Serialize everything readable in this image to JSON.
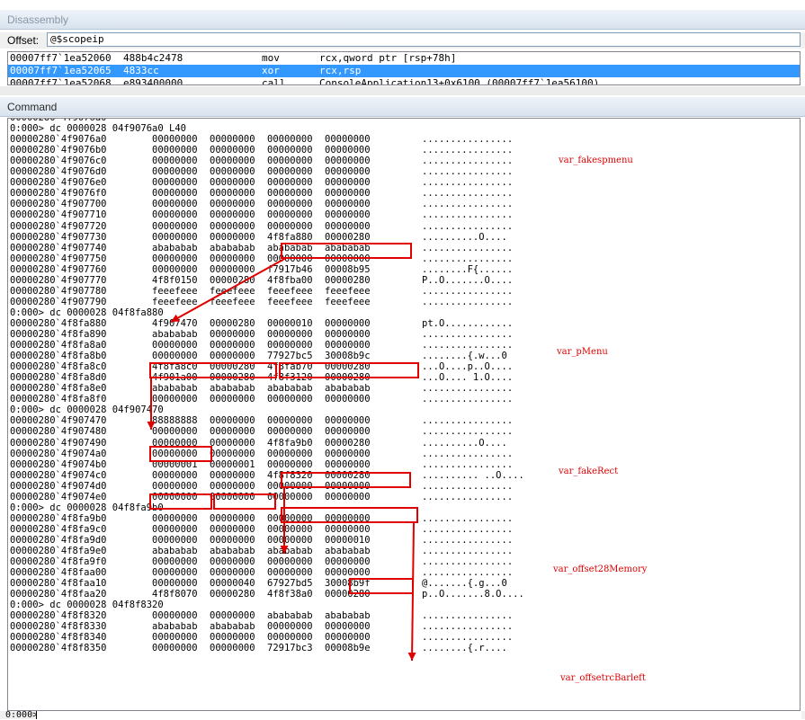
{
  "disassembly": {
    "title": "Disassembly",
    "offset_label": "Offset:",
    "offset_value": "@$scopeip",
    "lines": [
      {
        "addr": "00007ff7`1ea52060",
        "bytes": "488b4c2478",
        "op": "mov",
        "args": "rcx,qword ptr [rsp+78h]",
        "selected": false
      },
      {
        "addr": "00007ff7`1ea52065",
        "bytes": "4833cc",
        "op": "xor",
        "args": "rcx,rsp",
        "selected": true
      },
      {
        "addr": "00007ff7`1ea52068",
        "bytes": "e893400000",
        "op": "call",
        "args": "ConsoleApplication13+0x6100 (00007ff7`1ea56100)",
        "selected": false
      }
    ]
  },
  "command": {
    "title": "Command",
    "lines": [
      {
        "t": "row",
        "a": "00000280`4f9076a0",
        "w": [
          "",
          "",
          "",
          ""
        ],
        "s": ""
      },
      {
        "t": "cmd",
        "text": "0:000> dc 0000028 04f9076a0 L40"
      },
      {
        "t": "row",
        "a": "00000280`4f9076a0",
        "w": [
          "00000000",
          "00000000",
          "00000000",
          "00000000"
        ],
        "s": "................"
      },
      {
        "t": "row",
        "a": "00000280`4f9076b0",
        "w": [
          "00000000",
          "00000000",
          "00000000",
          "00000000"
        ],
        "s": "................"
      },
      {
        "t": "row",
        "a": "00000280`4f9076c0",
        "w": [
          "00000000",
          "00000000",
          "00000000",
          "00000000"
        ],
        "s": "................"
      },
      {
        "t": "row",
        "a": "00000280`4f9076d0",
        "w": [
          "00000000",
          "00000000",
          "00000000",
          "00000000"
        ],
        "s": "................"
      },
      {
        "t": "row",
        "a": "00000280`4f9076e0",
        "w": [
          "00000000",
          "00000000",
          "00000000",
          "00000000"
        ],
        "s": "................"
      },
      {
        "t": "row",
        "a": "00000280`4f9076f0",
        "w": [
          "00000000",
          "00000000",
          "00000000",
          "00000000"
        ],
        "s": "................"
      },
      {
        "t": "row",
        "a": "00000280`4f907700",
        "w": [
          "00000000",
          "00000000",
          "00000000",
          "00000000"
        ],
        "s": "................"
      },
      {
        "t": "row",
        "a": "00000280`4f907710",
        "w": [
          "00000000",
          "00000000",
          "00000000",
          "00000000"
        ],
        "s": "................"
      },
      {
        "t": "row",
        "a": "00000280`4f907720",
        "w": [
          "00000000",
          "00000000",
          "00000000",
          "00000000"
        ],
        "s": "................"
      },
      {
        "t": "row",
        "a": "00000280`4f907730",
        "w": [
          "00000000",
          "00000000",
          "4f8fa880",
          "00000280"
        ],
        "s": "..........O...."
      },
      {
        "t": "row",
        "a": "00000280`4f907740",
        "w": [
          "abababab",
          "abababab",
          "abababab",
          "abababab"
        ],
        "s": "................"
      },
      {
        "t": "row",
        "a": "00000280`4f907750",
        "w": [
          "00000000",
          "00000000",
          "00000000",
          "00000000"
        ],
        "s": "................"
      },
      {
        "t": "row",
        "a": "00000280`4f907760",
        "w": [
          "00000000",
          "00000000",
          "f7917b46",
          "00008b95"
        ],
        "s": "........F{......"
      },
      {
        "t": "row",
        "a": "00000280`4f907770",
        "w": [
          "4f8f0150",
          "00000280",
          "4f8fba00",
          "00000280"
        ],
        "s": "P..O.......O...."
      },
      {
        "t": "row",
        "a": "00000280`4f907780",
        "w": [
          "feeefeee",
          "feeefeee",
          "feeefeee",
          "feeefeee"
        ],
        "s": "................"
      },
      {
        "t": "row",
        "a": "00000280`4f907790",
        "w": [
          "feeefeee",
          "feeefeee",
          "feeefeee",
          "feeefeee"
        ],
        "s": "................"
      },
      {
        "t": "cmd",
        "text": "0:000> dc 0000028 04f8fa880"
      },
      {
        "t": "row",
        "a": "00000280`4f8fa880",
        "w": [
          "4f907470",
          "00000280",
          "00000010",
          "00000000"
        ],
        "s": "pt.O............"
      },
      {
        "t": "row",
        "a": "00000280`4f8fa890",
        "w": [
          "abababab",
          "00000000",
          "00000000",
          "00000000"
        ],
        "s": "................"
      },
      {
        "t": "row",
        "a": "00000280`4f8fa8a0",
        "w": [
          "00000000",
          "00000000",
          "00000000",
          "00000000"
        ],
        "s": "................"
      },
      {
        "t": "row",
        "a": "00000280`4f8fa8b0",
        "w": [
          "00000000",
          "00000000",
          "77927bc5",
          "30008b9c"
        ],
        "s": "........{.w...0"
      },
      {
        "t": "row",
        "a": "00000280`4f8fa8c0",
        "w": [
          "4f8fa8c0",
          "00000280",
          "4f8fab70",
          "00000280"
        ],
        "s": "...O....p..O...."
      },
      {
        "t": "row",
        "a": "00000280`4f8fa8d0",
        "w": [
          "4f901a00",
          "00000280",
          "4f8f3120",
          "00000280"
        ],
        "s": "...O.... 1.O...."
      },
      {
        "t": "row",
        "a": "00000280`4f8fa8e0",
        "w": [
          "abababab",
          "abababab",
          "abababab",
          "abababab"
        ],
        "s": "................"
      },
      {
        "t": "row",
        "a": "00000280`4f8fa8f0",
        "w": [
          "00000000",
          "00000000",
          "00000000",
          "00000000"
        ],
        "s": "................"
      },
      {
        "t": "cmd",
        "text": "0:000> dc 0000028 04f907470"
      },
      {
        "t": "row",
        "a": "00000280`4f907470",
        "w": [
          "88888888",
          "00000000",
          "00000000",
          "00000000"
        ],
        "s": "................"
      },
      {
        "t": "row",
        "a": "00000280`4f907480",
        "w": [
          "00000000",
          "00000000",
          "00000000",
          "00000000"
        ],
        "s": "................"
      },
      {
        "t": "row",
        "a": "00000280`4f907490",
        "w": [
          "00000000",
          "00000000",
          "4f8fa9b0",
          "00000280"
        ],
        "s": "..........O...."
      },
      {
        "t": "row",
        "a": "00000280`4f9074a0",
        "w": [
          "00000000",
          "00000000",
          "00000000",
          "00000000"
        ],
        "s": "................"
      },
      {
        "t": "row",
        "a": "00000280`4f9074b0",
        "w": [
          "00000001",
          "00000001",
          "00000000",
          "00000000"
        ],
        "s": "................"
      },
      {
        "t": "row",
        "a": "00000280`4f9074c0",
        "w": [
          "00000000",
          "00000000",
          "4f8f8320",
          "00000280"
        ],
        "s": ".......... ..O...."
      },
      {
        "t": "row",
        "a": "00000280`4f9074d0",
        "w": [
          "00000000",
          "00000000",
          "00000000",
          "00000000"
        ],
        "s": "................"
      },
      {
        "t": "row",
        "a": "00000280`4f9074e0",
        "w": [
          "00000000",
          "00000000",
          "00000000",
          "00000000"
        ],
        "s": "................"
      },
      {
        "t": "cmd",
        "text": "0:000> dc 0000028 04f8fa9b0"
      },
      {
        "t": "row",
        "a": "00000280`4f8fa9b0",
        "w": [
          "00000000",
          "00000000",
          "00000000",
          "00000000"
        ],
        "s": "................"
      },
      {
        "t": "row",
        "a": "00000280`4f8fa9c0",
        "w": [
          "00000000",
          "00000000",
          "00000000",
          "00000000"
        ],
        "s": "................"
      },
      {
        "t": "row",
        "a": "00000280`4f8fa9d0",
        "w": [
          "00000000",
          "00000000",
          "00000000",
          "00000010"
        ],
        "s": "................"
      },
      {
        "t": "row",
        "a": "00000280`4f8fa9e0",
        "w": [
          "abababab",
          "abababab",
          "abababab",
          "abababab"
        ],
        "s": "................"
      },
      {
        "t": "row",
        "a": "00000280`4f8fa9f0",
        "w": [
          "00000000",
          "00000000",
          "00000000",
          "00000000"
        ],
        "s": "................"
      },
      {
        "t": "row",
        "a": "00000280`4f8faa00",
        "w": [
          "00000000",
          "00000000",
          "00000000",
          "00000000"
        ],
        "s": "................"
      },
      {
        "t": "row",
        "a": "00000280`4f8faa10",
        "w": [
          "00000000",
          "00000040",
          "67927bd5",
          "30008b9f"
        ],
        "s": "@.......{.g...0"
      },
      {
        "t": "row",
        "a": "00000280`4f8faa20",
        "w": [
          "4f8f8070",
          "00000280",
          "4f8f38a0",
          "00000280"
        ],
        "s": "p..O.......8.O...."
      },
      {
        "t": "cmd",
        "text": "0:000> dc 0000028 04f8f8320"
      },
      {
        "t": "row",
        "a": "00000280`4f8f8320",
        "w": [
          "00000000",
          "00000000",
          "abababab",
          "abababab"
        ],
        "s": "................"
      },
      {
        "t": "row",
        "a": "00000280`4f8f8330",
        "w": [
          "abababab",
          "abababab",
          "00000000",
          "00000000"
        ],
        "s": "................"
      },
      {
        "t": "row",
        "a": "00000280`4f8f8340",
        "w": [
          "00000000",
          "00000000",
          "00000000",
          "00000000"
        ],
        "s": "................"
      },
      {
        "t": "row",
        "a": "00000280`4f8f8350",
        "w": [
          "00000000",
          "00000000",
          "72917bc3",
          "00008b9e"
        ],
        "s": "........{.r...."
      }
    ],
    "notes": [
      "var_fakespmenu",
      "var_pMenu",
      "var_fakeRect",
      "var_offset28Memory",
      "var_offsetrcBarleft"
    ],
    "prompt": "0:000>"
  },
  "colors": {
    "annotation": "#e00000",
    "selection": "#3399ff"
  }
}
